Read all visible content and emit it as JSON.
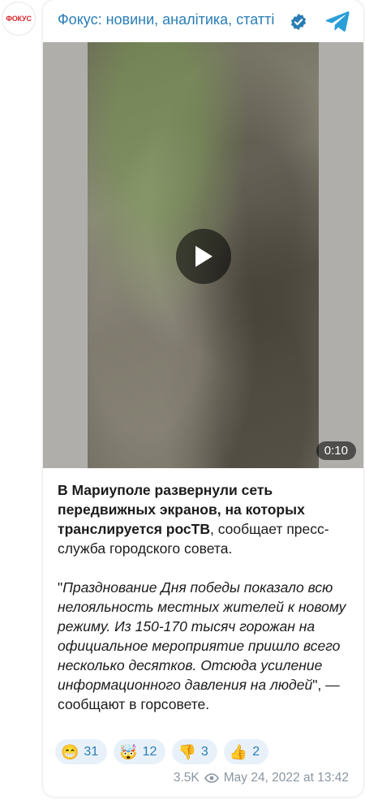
{
  "avatar": {
    "label": "ФОКУС"
  },
  "channel": {
    "title": "Фокус: новини, аналітика, статті"
  },
  "video": {
    "duration": "0:10"
  },
  "post": {
    "lead_bold": "В Мариуполе развернули сеть передвижных экранов, на которых транслируется росТВ",
    "lead_rest": ", сообщает пресс-служба городского совета.",
    "quote_open": "\"",
    "quote_italic": "Празднование Дня победы показало всю нелояльность местных жителей к новому режиму. Из 150-170 тысяч горожан на официальное мероприятие пришло всего несколько десятков. Отсюда усиление информационного давления на людей",
    "quote_rest": "\", — сообщают в горсовете."
  },
  "reactions": [
    {
      "emoji": "😁",
      "count": "31"
    },
    {
      "emoji": "🤯",
      "count": "12"
    },
    {
      "emoji": "👎",
      "count": "3"
    },
    {
      "emoji": "👍",
      "count": "2"
    }
  ],
  "footer": {
    "views": "3.5K",
    "date": "May 24, 2022 at 13:42"
  },
  "colors": {
    "accent": "#2a7db5",
    "brand_red": "#d8262b",
    "reaction_bg": "#e8f1fa",
    "meta": "#8b96a0"
  }
}
